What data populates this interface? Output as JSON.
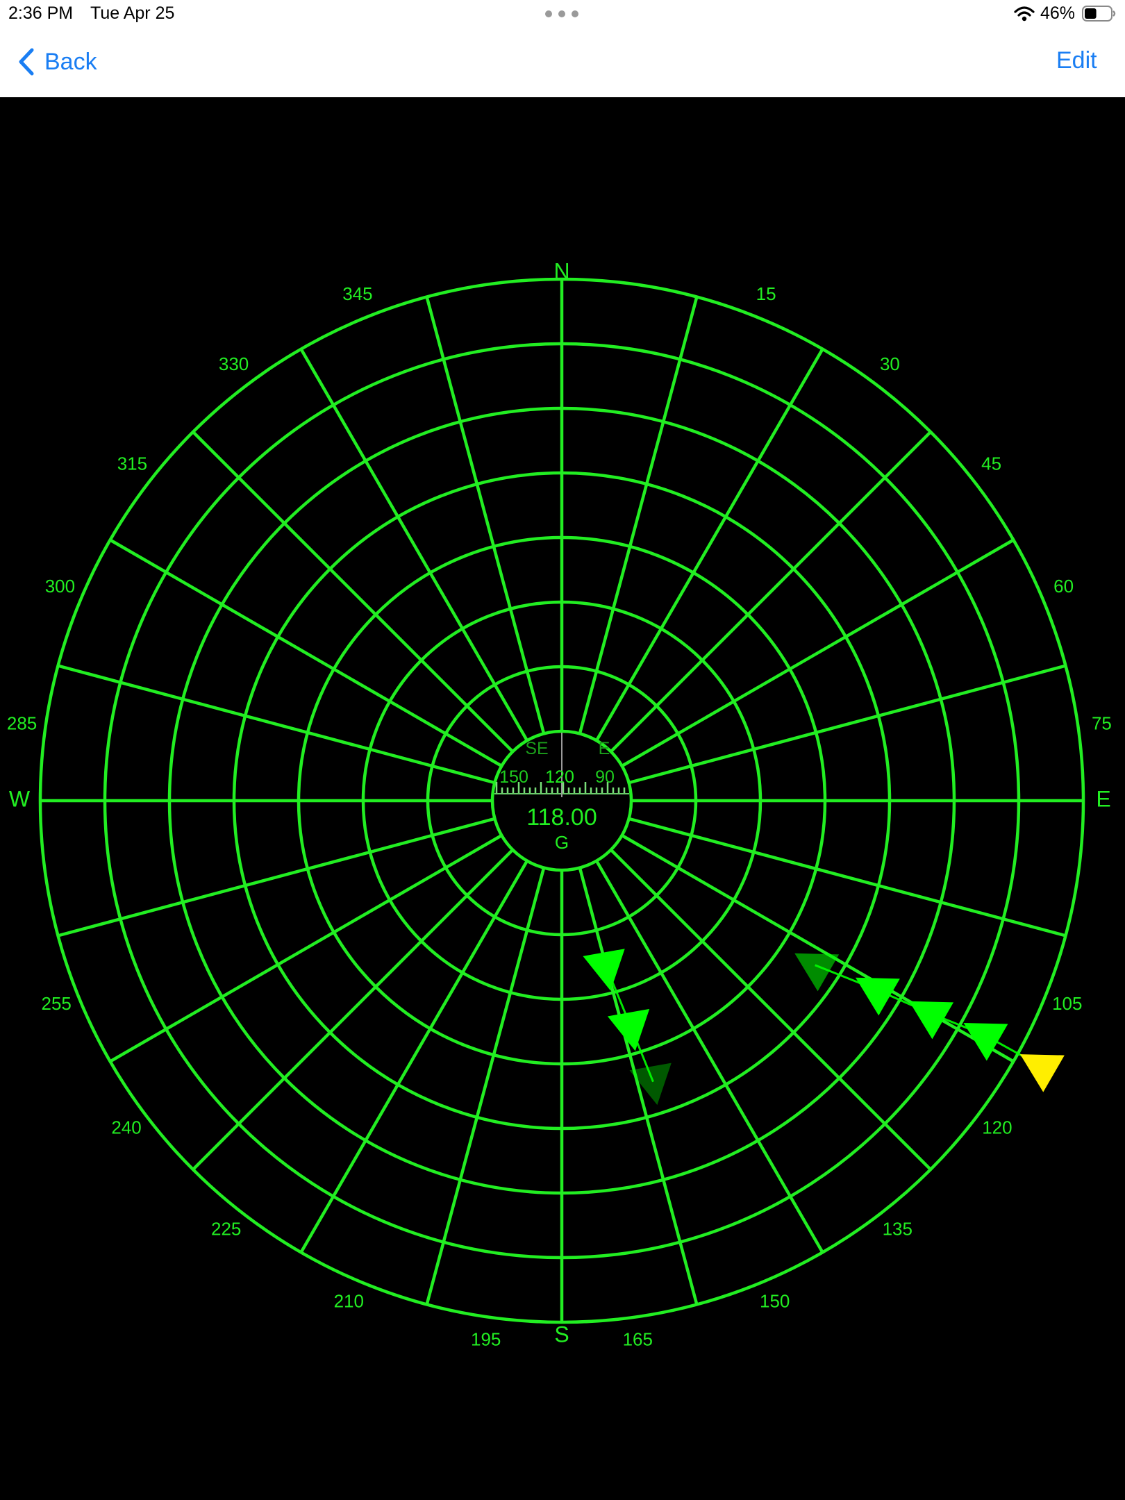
{
  "status_bar": {
    "time": "2:36 PM",
    "date": "Tue Apr 25",
    "battery_percent": "46%",
    "battery_level": 0.46,
    "icons": [
      "multitask-dots-icon",
      "wifi-icon",
      "battery-icon"
    ]
  },
  "nav_bar": {
    "back_label": "Back",
    "edit_label": "Edit",
    "icons": [
      "chevron-left-icon"
    ]
  },
  "radar": {
    "cardinals": {
      "north": "N",
      "east": "E",
      "south": "S",
      "west": "W"
    },
    "bearing_labels": [
      "15",
      "30",
      "45",
      "60",
      "75",
      "105",
      "120",
      "135",
      "150",
      "165",
      "195",
      "210",
      "225",
      "240",
      "255",
      "285",
      "300",
      "315",
      "330",
      "345"
    ],
    "ring_count": 8,
    "spoke_step_deg": 15,
    "colors": {
      "grid": "#22ee22",
      "marker": "#00ff00",
      "current_marker": "#ffee00",
      "background": "#000000"
    }
  },
  "heading_indicator": {
    "value": "118.00",
    "mode": "G",
    "tape_directions": [
      "SE",
      "E"
    ],
    "tape_numbers": [
      "150",
      "120",
      "90"
    ]
  },
  "tracks": [
    {
      "name": "track-a",
      "points": [
        {
          "bearing": 123,
          "distance": 3.6,
          "opacity": 0.55,
          "heading": 300
        },
        {
          "bearing": 121,
          "distance": 4.6,
          "opacity": 1.0,
          "heading": 300
        },
        {
          "bearing": 120,
          "distance": 5.5,
          "opacity": 1.0,
          "heading": 300
        },
        {
          "bearing": 119,
          "distance": 6.4,
          "opacity": 1.0,
          "heading": 300
        },
        {
          "bearing": 119,
          "distance": 7.4,
          "opacity": 1.0,
          "heading": 300,
          "current": true
        }
      ]
    },
    {
      "name": "track-b",
      "points": [
        {
          "bearing": 165,
          "distance": 1.6,
          "opacity": 1.0,
          "heading": 170
        },
        {
          "bearing": 163,
          "distance": 2.6,
          "opacity": 1.0,
          "heading": 170
        },
        {
          "bearing": 162,
          "distance": 3.5,
          "opacity": 0.35,
          "heading": 170
        }
      ]
    }
  ]
}
